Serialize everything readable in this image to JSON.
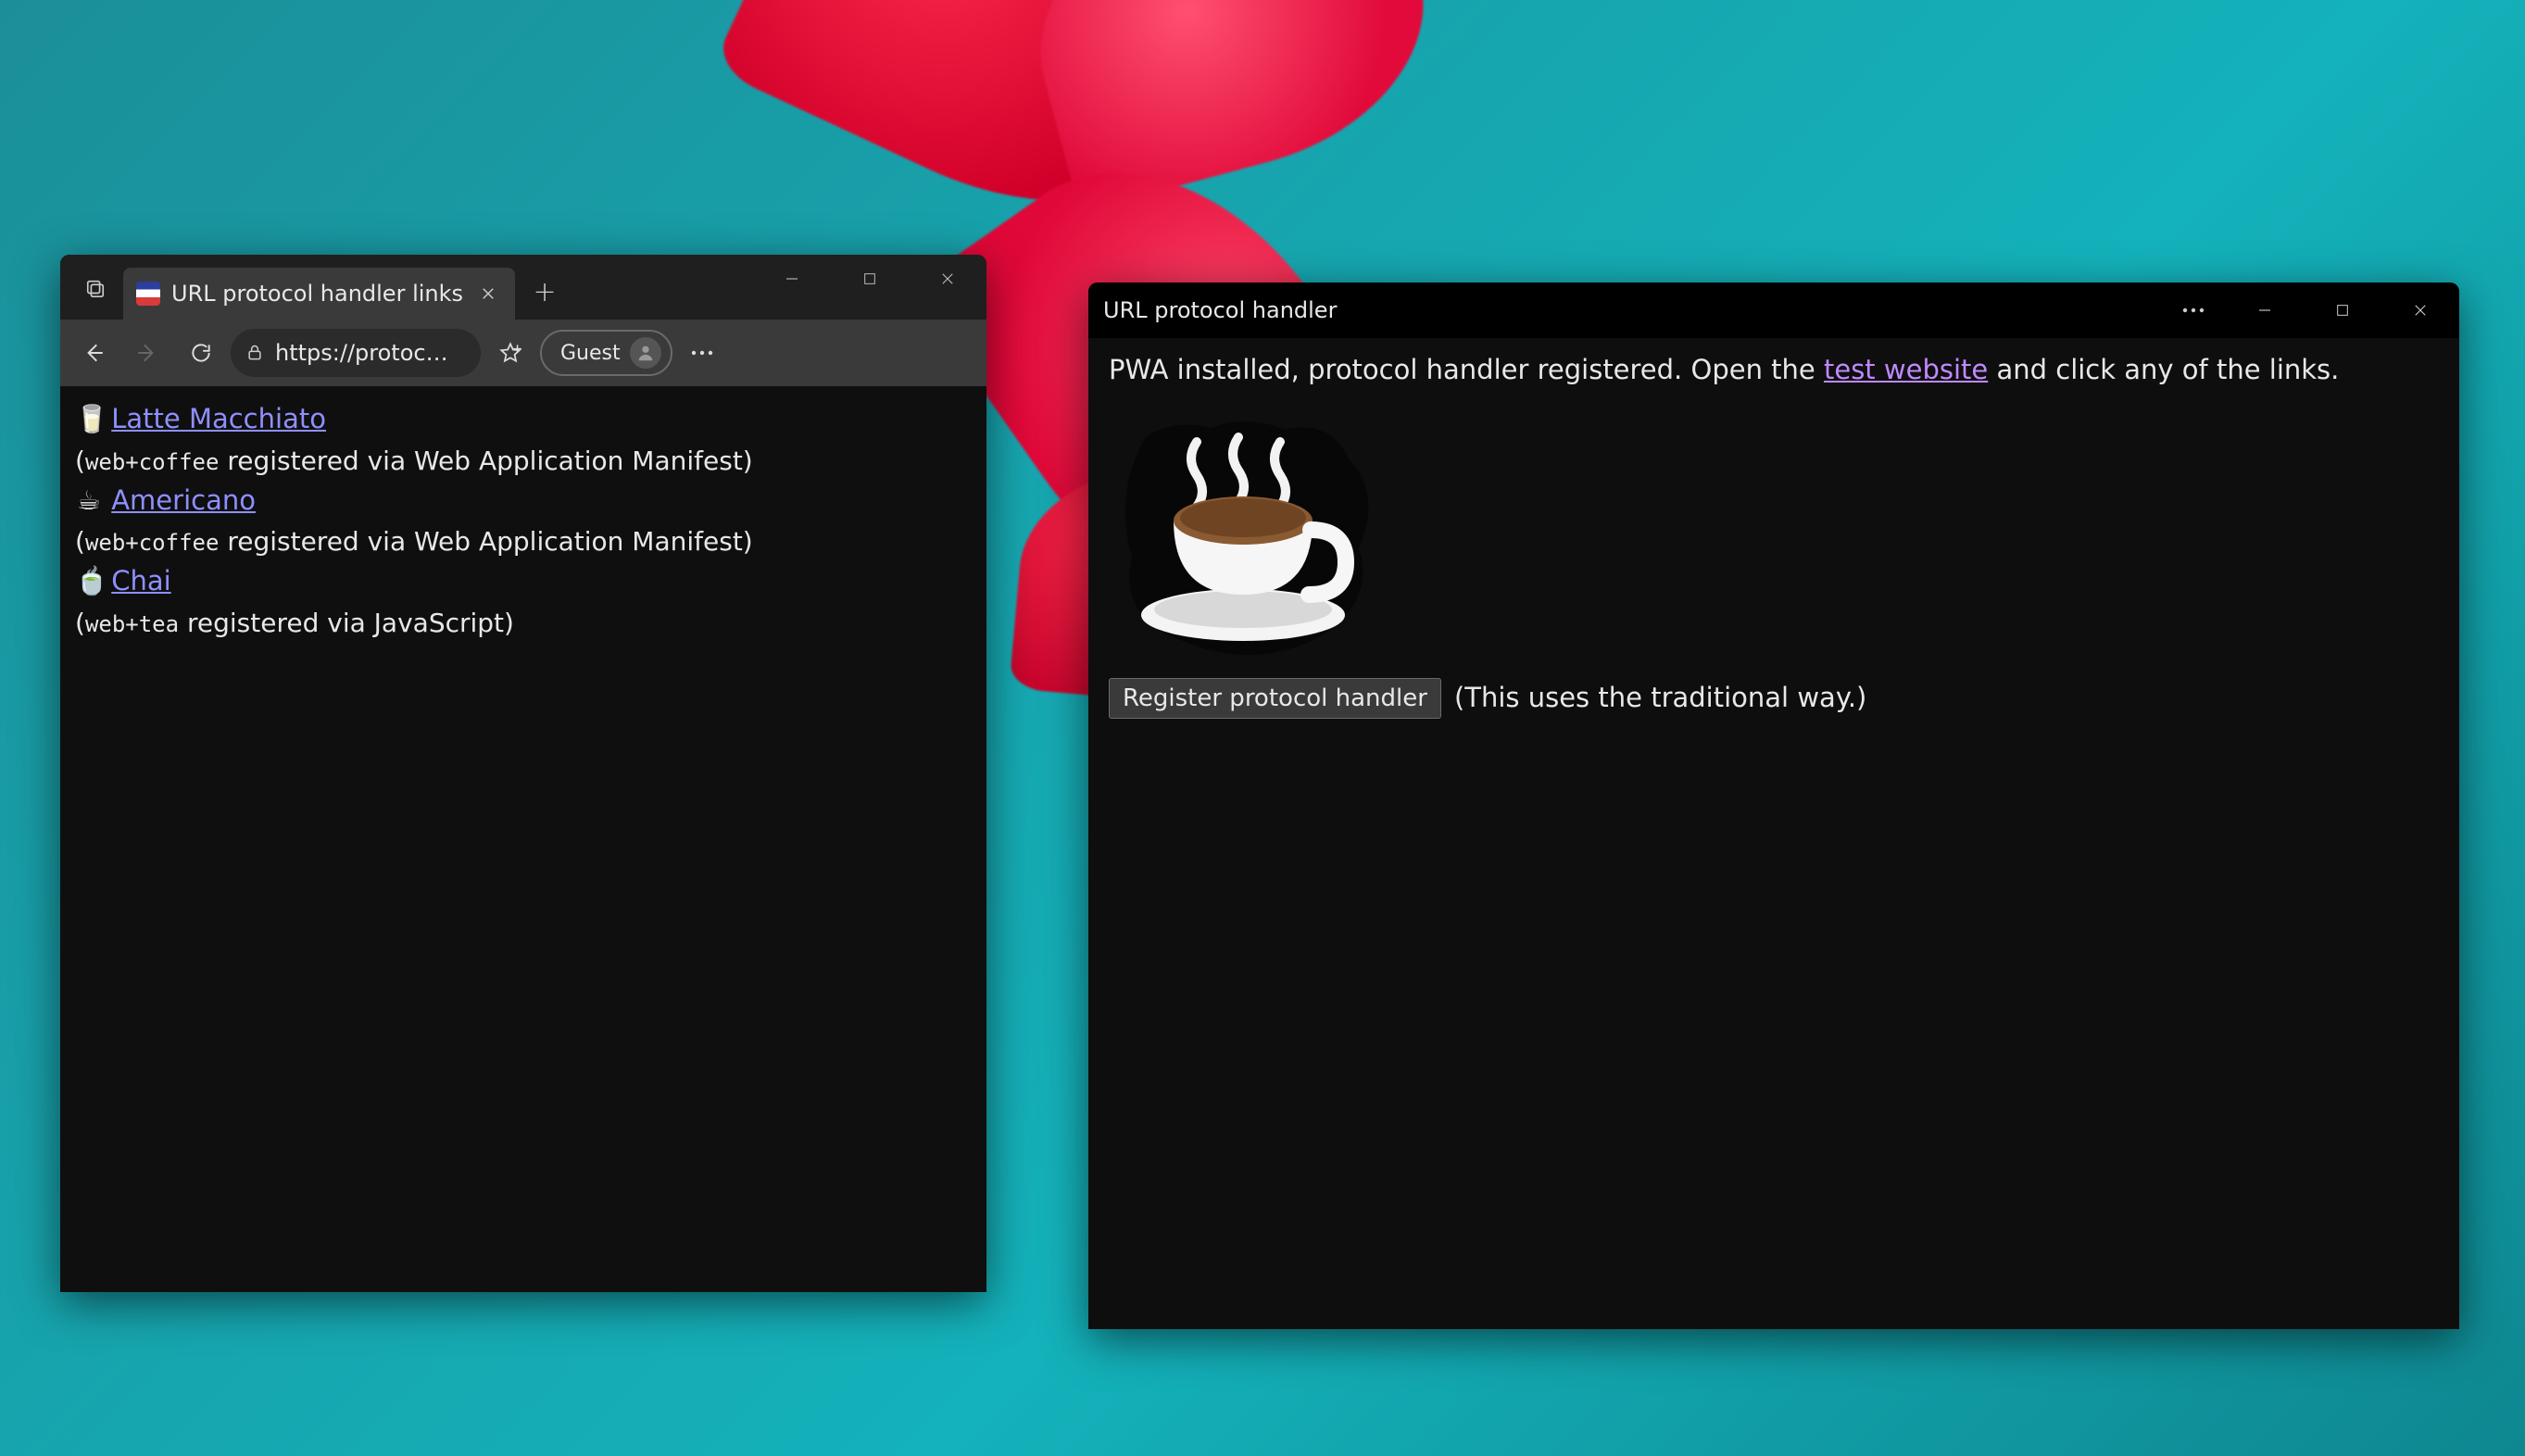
{
  "browser": {
    "tab_title": "URL protocol handler links",
    "address": "https://protoc…",
    "guest_label": "Guest",
    "links": [
      {
        "emoji": "🥛",
        "label": " Latte Macchiato",
        "protocol": "web+coffee",
        "via": " registered via Web Application Manifest)"
      },
      {
        "emoji": "☕",
        "label": " Americano",
        "protocol": "web+coffee",
        "via": " registered via Web Application Manifest)"
      },
      {
        "emoji": "🍵",
        "label": " Chai",
        "protocol": "web+tea",
        "via": " registered via JavaScript)"
      }
    ]
  },
  "pwa": {
    "title": "URL protocol handler",
    "intro_before_link": "PWA installed, protocol handler registered. Open the ",
    "intro_link": "test website",
    "intro_after_link": " and click any of the links.",
    "register_button": "Register protocol handler",
    "register_note": "(This uses the traditional way.)"
  }
}
